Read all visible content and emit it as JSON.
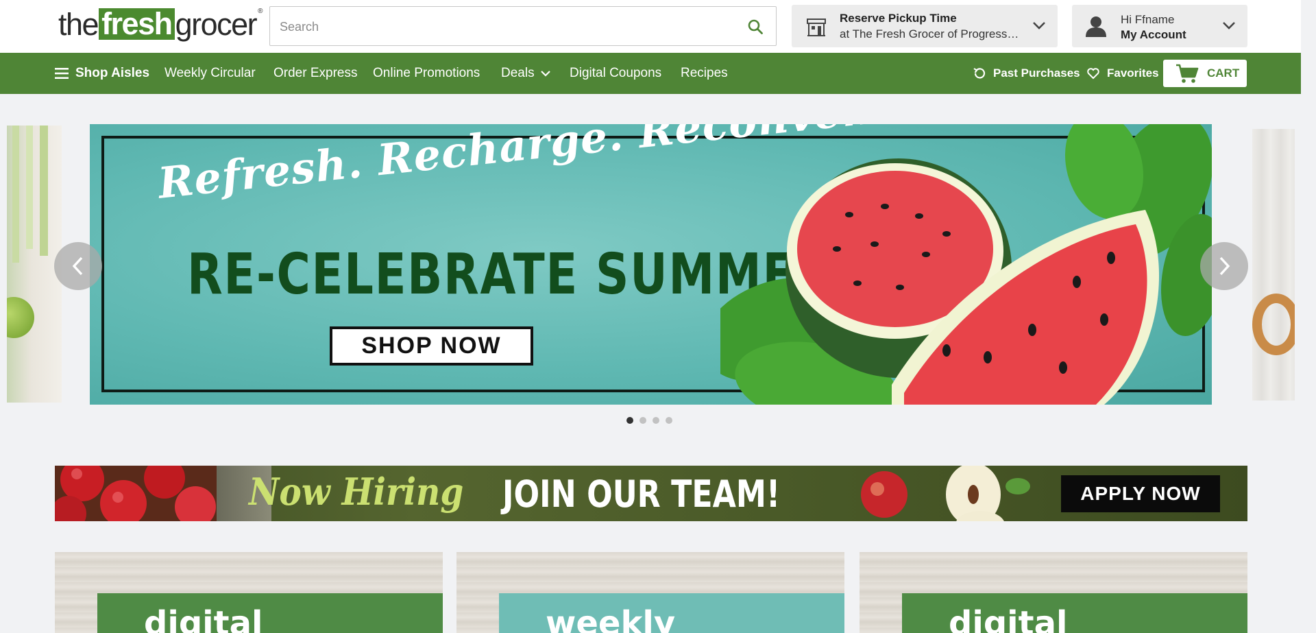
{
  "header": {
    "logo": {
      "part1": "the",
      "part2": "fresh",
      "part3": "grocer",
      "mark": "®"
    },
    "search": {
      "placeholder": "Search",
      "value": "",
      "icon": "search-icon"
    },
    "pickup": {
      "title": "Reserve Pickup Time",
      "subtitle": "at The Fresh Grocer of Progress Pl...",
      "icon": "store-icon"
    },
    "account": {
      "greeting": "Hi Ffname",
      "label": "My Account",
      "icon": "user-icon"
    }
  },
  "nav": {
    "shop_aisles": "Shop Aisles",
    "items": [
      {
        "label": "Weekly Circular"
      },
      {
        "label": "Order Express"
      },
      {
        "label": "Online Promotions"
      },
      {
        "label": "Deals"
      },
      {
        "label": "Digital Coupons"
      },
      {
        "label": "Recipes"
      }
    ],
    "past_purchases": "Past Purchases",
    "favorites": "Favorites",
    "cart": "CART"
  },
  "carousel": {
    "slide": {
      "tagline": "Refresh. Recharge. Reconvene.",
      "headline": "RE-CELEBRATE SUMMER",
      "cta": "SHOP NOW"
    },
    "dot_count": 4,
    "active_index": 0
  },
  "hiring": {
    "script_text": "Now Hiring",
    "headline": "JOIN OUR TEAM!",
    "cta": "APPLY NOW"
  },
  "cards": [
    {
      "label": "digital"
    },
    {
      "label": "weekly"
    },
    {
      "label": "digital"
    }
  ],
  "colors": {
    "brand_green": "#4f8536",
    "banner_teal": "#5fb8b2",
    "headline_green": "#124d1d",
    "hiring_lime": "#cbe071"
  }
}
